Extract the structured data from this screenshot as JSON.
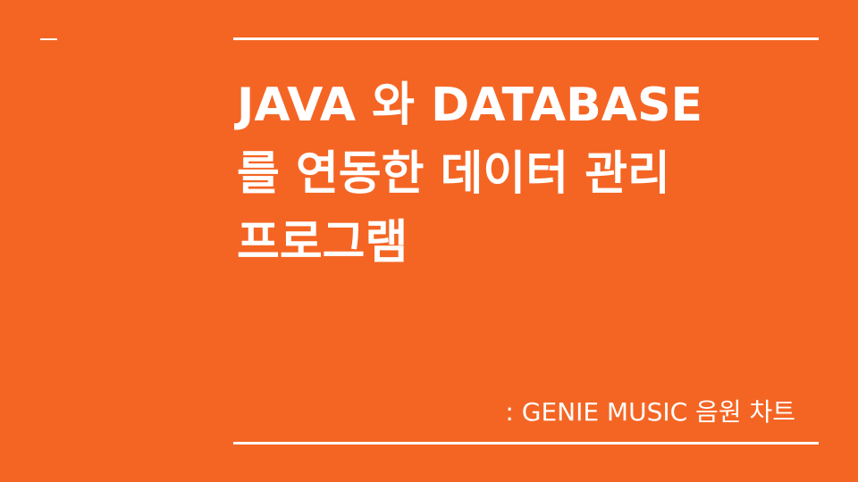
{
  "slide": {
    "background_color": "#f46524",
    "title_lines": [
      "JAVA 와 DATABASE",
      "를 연동한 데이터 관리",
      "프로그램"
    ],
    "subtitle": ": GENIE MUSIC 음원 차트"
  }
}
